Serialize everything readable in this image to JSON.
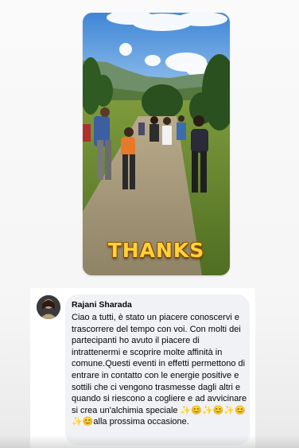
{
  "story": {
    "sticker_text": "THANKS"
  },
  "comment": {
    "author": "Rajani Sharada",
    "text": "Ciao a tutti, è stato un piacere conoscervi e trascorrere del tempo con voi. Con molti dei partecipanti ho avuto il piacere di intrattenermi e scoprire molte affinità in comune.Questi eventi in effetti permettono di entrare in contatto con le energie positive e sottili che ci vengono trasmesse dagli altri e quando si riescono a cogliere e ad avvicinare si crea un'alchimia speciale ✨😊✨😊✨😊✨😊alla prossima occasione."
  }
}
